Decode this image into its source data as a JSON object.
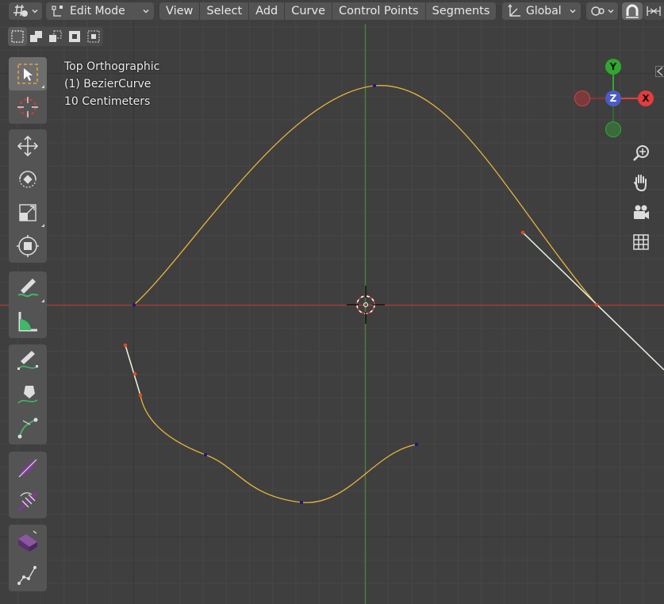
{
  "header": {
    "mode_label": "Edit Mode",
    "menus": [
      "View",
      "Select",
      "Add",
      "Curve",
      "Control Points",
      "Segments"
    ],
    "orientation_label": "Global"
  },
  "overlay": {
    "view_name": "Top Orthographic",
    "object_name": "(1) BezierCurve",
    "scale": "10 Centimeters"
  },
  "gizmo": {
    "y": "Y",
    "z": "Z",
    "x": "X"
  },
  "colors": {
    "viewport_bg": "#3f3f3f",
    "curve": "#e7b43a",
    "x_axis": "#a33a3a",
    "y_axis": "#4e7a43",
    "handle_line": "#e8f5e0",
    "selected_point": "#e54a22",
    "control_point": "#1a1a7a",
    "gizmo_x": "#e53c3c",
    "gizmo_y": "#2fa830",
    "gizmo_z": "#4a5cc6"
  },
  "icons": [
    "editor-type-icon",
    "edit-mode-icon",
    "transform-orientation-icon",
    "snap-icon",
    "proportional-editing-icon",
    "select-box-icon",
    "cursor-icon",
    "move-icon",
    "rotate-icon",
    "scale-icon",
    "transform-icon",
    "annotate-icon",
    "measure-icon",
    "draw-icon",
    "pen-icon",
    "curve-pen-icon",
    "radius-icon",
    "tilt-icon",
    "extrude-icon",
    "randomize-icon",
    "zoom-icon",
    "hand-icon",
    "camera-icon",
    "grid-icon"
  ]
}
